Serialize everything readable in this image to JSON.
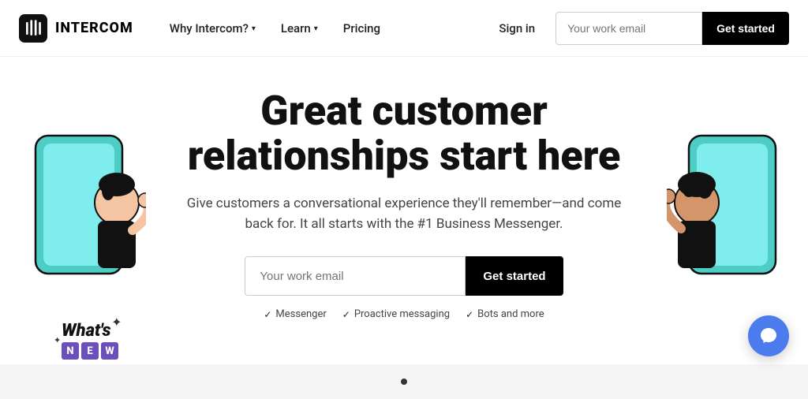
{
  "nav": {
    "logo_text": "INTERCOM",
    "links": [
      {
        "label": "Why Intercom?",
        "has_dropdown": true
      },
      {
        "label": "Learn",
        "has_dropdown": true
      },
      {
        "label": "Pricing",
        "has_dropdown": false
      },
      {
        "label": "Sign in",
        "has_dropdown": false
      }
    ],
    "email_placeholder": "Your work email",
    "cta_label": "Get started"
  },
  "hero": {
    "title_line1": "Great customer",
    "title_line2": "relationships start here",
    "subtitle": "Give customers a conversational experience they'll remember—and come back for. It all starts with the #1 Business Messenger.",
    "email_placeholder": "Your work email",
    "cta_label": "Get started",
    "checks": [
      {
        "label": "Messenger"
      },
      {
        "label": "Proactive messaging"
      },
      {
        "label": "Bots and more"
      }
    ]
  },
  "whats_new": {
    "title": "What's",
    "badge_letters": [
      "N",
      "E",
      "W"
    ]
  },
  "chat_widget": {
    "aria_label": "Open chat"
  }
}
